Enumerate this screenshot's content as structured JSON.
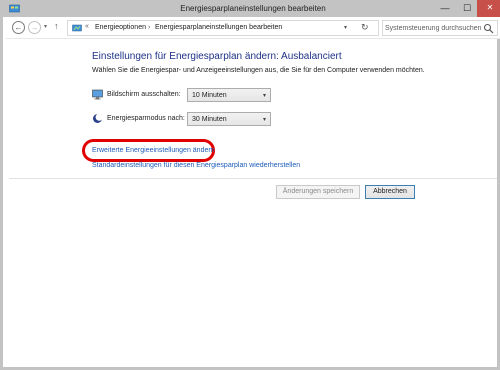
{
  "window": {
    "title": "Energiesparplaneinstellungen bearbeiten",
    "minimize_symbol": "—",
    "maximize_symbol": "☐",
    "close_symbol": "✕"
  },
  "nav": {
    "back_symbol": "←",
    "forward_symbol": "→",
    "recent_symbol": "▾",
    "up_symbol": "↑"
  },
  "address": {
    "more_symbol": "«",
    "crumbs": [
      "Energieoptionen",
      "Energiesparplaneinstellungen bearbeiten"
    ],
    "separator": "›",
    "dropdown_symbol": "▾",
    "refresh_symbol": "↻"
  },
  "search": {
    "placeholder": "Systemsteuerung durchsuchen"
  },
  "content": {
    "heading": "Einstellungen für Energiesparplan ändern: Ausbalanciert",
    "subtitle": "Wählen Sie die Energiespar- und Anzeigeeinstellungen aus, die Sie für den Computer verwenden möchten.",
    "settings": [
      {
        "label": "Bildschirm ausschalten:",
        "value": "10 Minuten",
        "icon": "monitor-icon"
      },
      {
        "label": "Energiesparmodus nach:",
        "value": "30 Minuten",
        "icon": "moon-icon"
      }
    ],
    "select_arrow": "▾",
    "links": {
      "advanced": "Erweiterte Energieeinstellungen ändern",
      "restore": "Standardeinstellungen für diesen Energiesparplan wiederherstellen"
    }
  },
  "buttons": {
    "save": "Änderungen speichern",
    "cancel": "Abbrechen"
  },
  "colors": {
    "heading": "#1e3287",
    "link": "#1e5bb8",
    "highlight": "#e00000",
    "close_button": "#c7504b"
  }
}
